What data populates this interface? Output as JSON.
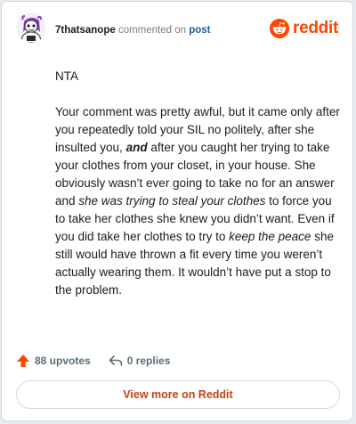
{
  "header": {
    "username": "7thatsanope",
    "action_text": " commented on ",
    "post_link": "post",
    "logo_text": "reddit"
  },
  "comment": {
    "line1": "NTA",
    "p2_a": "Your comment was pretty awful, but it came only after you repeatedly told your SIL no politely, after she insulted you, ",
    "p2_b": "and",
    "p2_c": " after you caught her trying to take your clothes from your closet, in your house. She obviously wasn’t ever going to take no for an answer and ",
    "p2_d": "she was trying to steal your clothes",
    "p2_e": " to force you to take her clothes she knew you didn’t want. Even if you did take her clothes to try to ",
    "p2_f": "keep the peace",
    "p2_g": " she still would have thrown a fit every time you weren’t actually wearing them. It wouldn’t have put a stop to the problem."
  },
  "footer": {
    "upvotes": "88 upvotes",
    "replies": "0 replies",
    "view_more": "View more on Reddit"
  },
  "colors": {
    "brand": "#ff4500",
    "link": "#1a5fa6",
    "button_text": "#c64110"
  },
  "icons": {
    "avatar": "snoo-avatar",
    "logo": "reddit-logo-icon",
    "upvote": "upvote-arrow-icon",
    "reply": "reply-arrow-icon"
  }
}
